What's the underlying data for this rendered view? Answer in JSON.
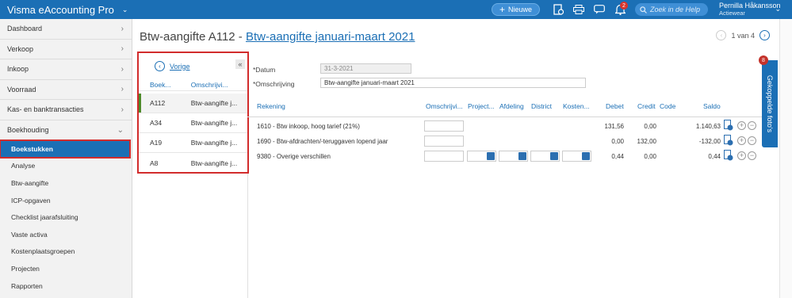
{
  "app": {
    "title": "Visma eAccounting Pro"
  },
  "topbar": {
    "new_label": "Nieuwe",
    "help_placeholder": "Zoek in de Help",
    "notification_count": "2",
    "user_name": "Pernilla Håkansson",
    "company": "Actiewear"
  },
  "sidebar": {
    "items": [
      {
        "label": "Dashboard"
      },
      {
        "label": "Verkoop"
      },
      {
        "label": "Inkoop"
      },
      {
        "label": "Voorraad"
      },
      {
        "label": "Kas- en banktransacties"
      },
      {
        "label": "Boekhouding"
      }
    ],
    "sub_items": [
      {
        "label": "Boekstukken"
      },
      {
        "label": "Analyse"
      },
      {
        "label": "Btw-aangifte"
      },
      {
        "label": "ICP-opgaven"
      },
      {
        "label": "Checklist jaarafsluiting"
      },
      {
        "label": "Vaste activa"
      },
      {
        "label": "Kostenplaatsgroepen"
      },
      {
        "label": "Projecten"
      },
      {
        "label": "Rapporten"
      }
    ]
  },
  "header": {
    "title_prefix": "Btw-aangifte A112  -",
    "title_link": "Btw-aangifte januari-maart 2021",
    "pager_text": "1 van 4"
  },
  "list": {
    "back_label": "Vorige",
    "col1": "Boek...",
    "col2": "Omschrijvi...",
    "rows": [
      {
        "id": "A112",
        "desc": "Btw-aangifte j..."
      },
      {
        "id": "A34",
        "desc": "Btw-aangifte j..."
      },
      {
        "id": "A19",
        "desc": "Btw-aangifte j..."
      },
      {
        "id": "A8",
        "desc": "Btw-aangifte j..."
      }
    ]
  },
  "form": {
    "date_label": "*Datum",
    "date_value": "31-3-2021",
    "desc_label": "*Omschrijving",
    "desc_value": "Btw-aangifte januari-maart 2021"
  },
  "table": {
    "headers": {
      "rekening": "Rekening",
      "omschrijving": "Omschrijvi...",
      "project": "Project...",
      "afdeling": "Afdeling",
      "district": "District",
      "kosten": "Kosten...",
      "debet": "Debet",
      "credit": "Credit",
      "code": "Code",
      "saldo": "Saldo"
    },
    "rows": [
      {
        "rekening": "1610 - Btw inkoop, hoog tarief (21%)",
        "debet": "131,56",
        "credit": "0,00",
        "saldo": "1.140,63"
      },
      {
        "rekening": "1690 - Btw-afdrachten/-teruggaven lopend jaar",
        "debet": "0,00",
        "credit": "132,00",
        "saldo": "-132,00"
      },
      {
        "rekening": "9380 - Overige verschillen",
        "debet": "0,44",
        "credit": "0,00",
        "saldo": "0,44"
      }
    ]
  },
  "side_tab": {
    "label": "Gekoppelde foto's",
    "count": "8"
  }
}
